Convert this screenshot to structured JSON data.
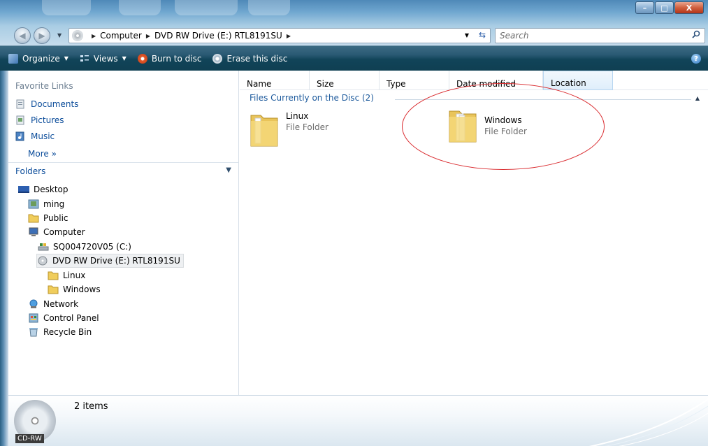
{
  "window": {
    "controls": {
      "minimize": "–",
      "maximize": "□",
      "close": "X"
    }
  },
  "address": {
    "crumbs": [
      "Computer",
      "DVD RW Drive (E:) RTL8191SU"
    ],
    "search_placeholder": "Search"
  },
  "toolbar": {
    "organize": "Organize",
    "views": "Views",
    "burn": "Burn to disc",
    "erase": "Erase this disc",
    "help": "?"
  },
  "sidebar": {
    "favorites_header": "Favorite Links",
    "favorites": [
      {
        "label": "Documents",
        "icon": "documents-icon"
      },
      {
        "label": "Pictures",
        "icon": "pictures-icon"
      },
      {
        "label": "Music",
        "icon": "music-icon"
      }
    ],
    "more": "More »",
    "folders_header": "Folders",
    "tree": [
      {
        "label": "Desktop",
        "icon": "desktop-icon"
      },
      {
        "label": "ming",
        "icon": "user-folder-icon"
      },
      {
        "label": "Public",
        "icon": "folder-icon"
      },
      {
        "label": "Computer",
        "icon": "computer-icon"
      },
      {
        "label": "SQ004720V05 (C:)",
        "icon": "hard-drive-icon"
      },
      {
        "label": "DVD RW Drive (E:) RTL8191SU",
        "icon": "dvd-drive-icon",
        "selected": true
      },
      {
        "label": "Linux",
        "icon": "folder-icon"
      },
      {
        "label": "Windows",
        "icon": "folder-icon"
      },
      {
        "label": "Network",
        "icon": "network-icon"
      },
      {
        "label": "Control Panel",
        "icon": "control-panel-icon"
      },
      {
        "label": "Recycle Bin",
        "icon": "recycle-bin-icon"
      }
    ]
  },
  "content": {
    "columns": [
      "Name",
      "Size",
      "Type",
      "Date modified",
      "Location"
    ],
    "group_header": "Files Currently on the Disc (2)",
    "files": [
      {
        "name": "Linux",
        "type": "File Folder"
      },
      {
        "name": "Windows",
        "type": "File Folder"
      }
    ]
  },
  "details": {
    "drive_label": "CD-RW",
    "item_count": "2 items"
  },
  "colors": {
    "toolbar_bg": "#114459",
    "link_blue": "#0b4c9a",
    "annotation_red": "#d9282c"
  }
}
